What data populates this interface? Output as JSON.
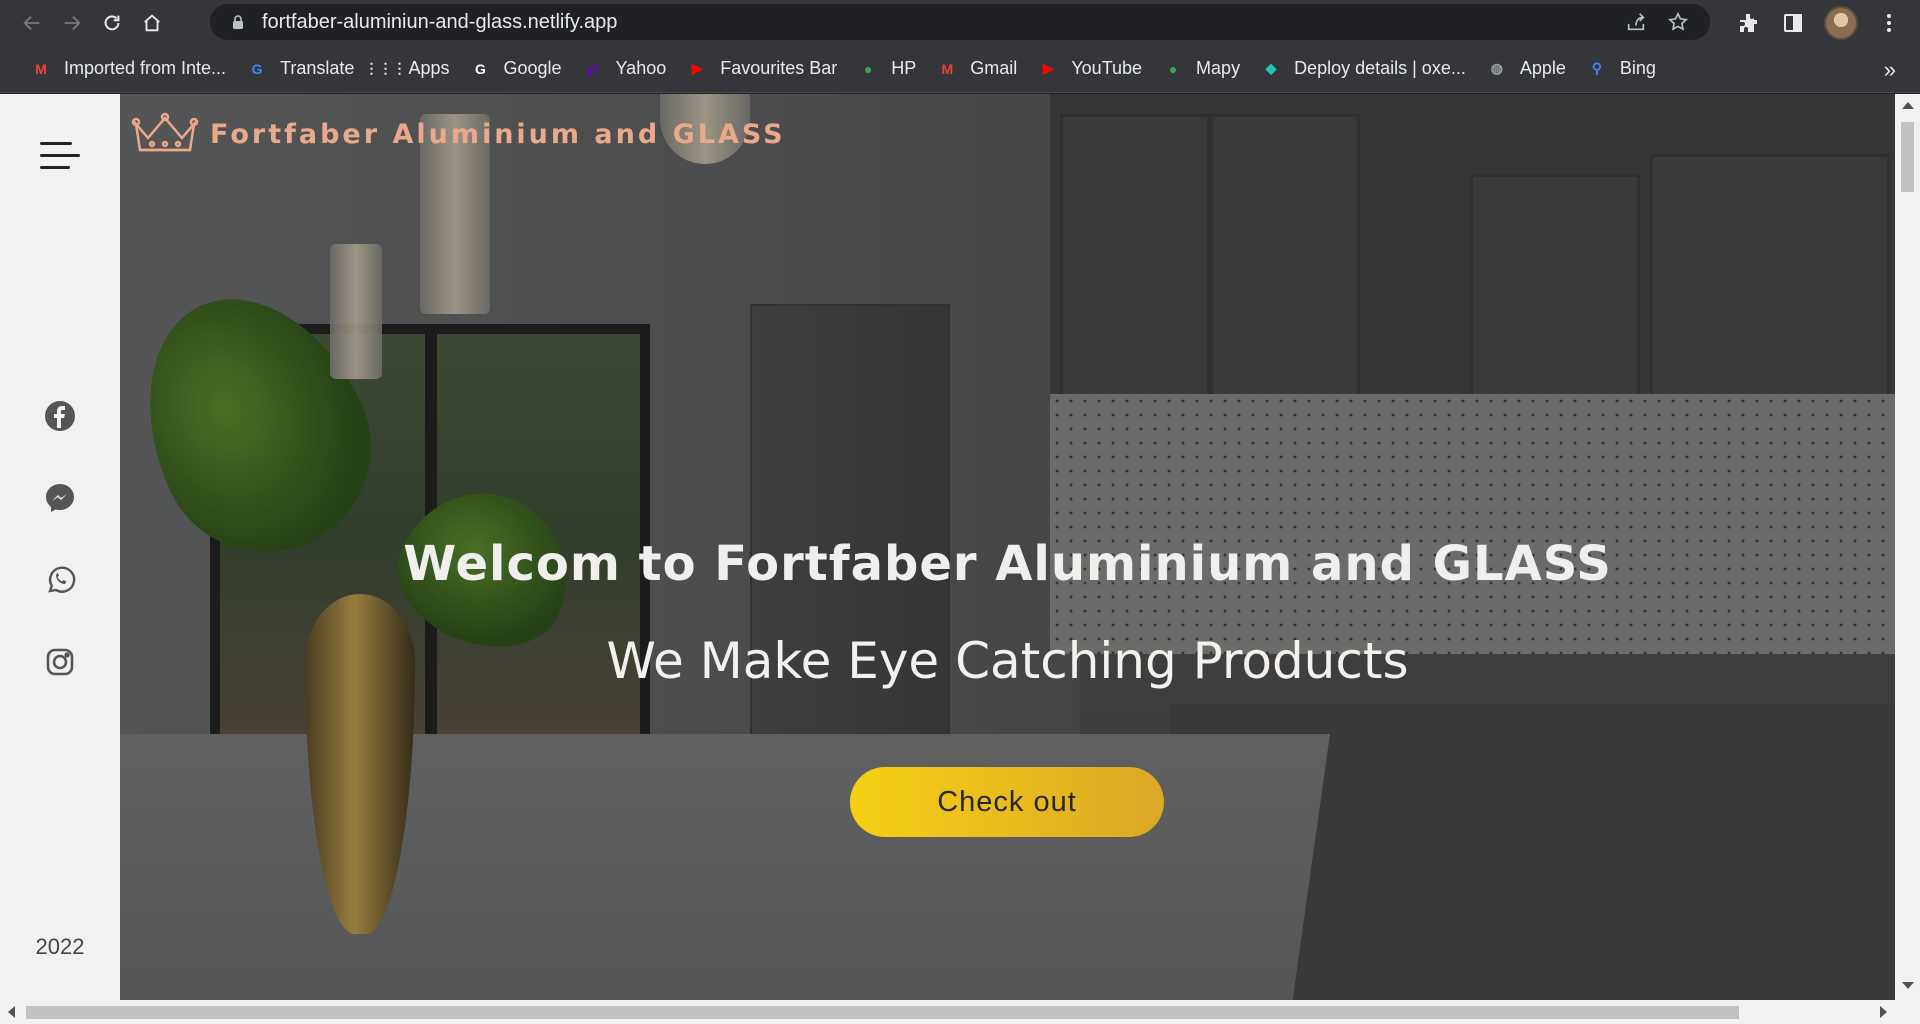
{
  "browser": {
    "url": "fortfaber-aluminiun-and-glass.netlify.app",
    "bookmarks": [
      {
        "label": "Imported from Inte...",
        "icon": "gmail-icon",
        "color": "#ea4335",
        "glyph": "M"
      },
      {
        "label": "Translate",
        "icon": "google-translate-icon",
        "color": "#4285f4",
        "glyph": "G"
      },
      {
        "label": "Apps",
        "icon": "apps-grid-icon",
        "color": "#e8eaed",
        "glyph": "⋮⋮⋮"
      },
      {
        "label": "Google",
        "icon": "google-icon",
        "color": "#ffffff",
        "glyph": "G"
      },
      {
        "label": "Yahoo",
        "icon": "yahoo-icon",
        "color": "#6001d2",
        "glyph": "y!"
      },
      {
        "label": "Favourites Bar",
        "icon": "youtube-icon",
        "color": "#ff0000",
        "glyph": "▶"
      },
      {
        "label": "HP",
        "icon": "maps-pin-icon",
        "color": "#34a853",
        "glyph": "●"
      },
      {
        "label": "Gmail",
        "icon": "gmail-icon",
        "color": "#ea4335",
        "glyph": "M"
      },
      {
        "label": "YouTube",
        "icon": "youtube-icon",
        "color": "#ff0000",
        "glyph": "▶"
      },
      {
        "label": "Mapy",
        "icon": "maps-pin-icon",
        "color": "#34a853",
        "glyph": "●"
      },
      {
        "label": "Deploy details | oxe...",
        "icon": "netlify-icon",
        "color": "#20c6b7",
        "glyph": "◆"
      },
      {
        "label": "Apple",
        "icon": "globe-icon",
        "color": "#9aa0a6",
        "glyph": "◍"
      },
      {
        "label": "Bing",
        "icon": "search-icon",
        "color": "#4285f4",
        "glyph": "⚲"
      }
    ]
  },
  "site": {
    "brand_name": "Fortfaber Aluminium and GLASS",
    "brand_color": "#e9a98a",
    "year": "2022",
    "social": [
      "facebook-icon",
      "messenger-icon",
      "whatsapp-icon",
      "instagram-icon"
    ],
    "hero": {
      "title": "Welcom to Fortfaber Aluminium and GLASS",
      "subtitle": "We Make Eye Catching Products",
      "cta_label": "Check out",
      "cta_color": "#f7cf14"
    }
  }
}
